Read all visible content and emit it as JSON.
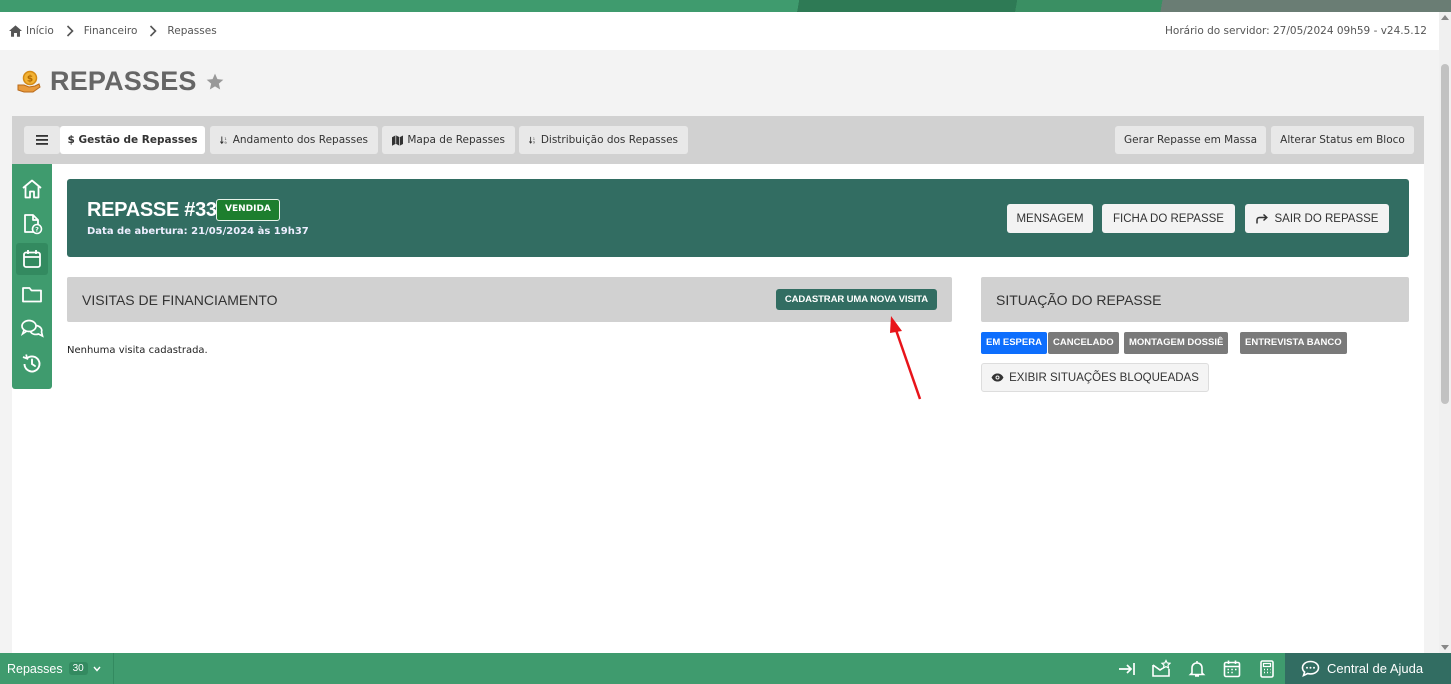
{
  "breadcrumb": {
    "items": [
      {
        "label": "Início"
      },
      {
        "label": "Financeiro"
      },
      {
        "label": "Repasses"
      }
    ],
    "server_time": "Horário do servidor: 27/05/2024 09h59 - v24.5.12"
  },
  "page": {
    "title": "REPASSES"
  },
  "tabs": [
    {
      "label": "$ Gestão de Repasses",
      "active": true
    },
    {
      "label": "Andamento dos Repasses",
      "active": false
    },
    {
      "label": "Mapa de Repasses",
      "active": false
    },
    {
      "label": "Distribuição dos Repasses",
      "active": false
    }
  ],
  "toolbar": {
    "mass_label": "Gerar Repasse em Massa",
    "bulk_status_label": "Alterar Status em Bloco"
  },
  "repasse": {
    "title": "REPASSE #339",
    "status_badge": "VENDIDA",
    "opened": "Data de abertura: 21/05/2024 às 19h37",
    "btn_mensagem": "MENSAGEM",
    "btn_ficha": "FICHA DO REPASSE",
    "btn_sair": "SAIR DO REPASSE"
  },
  "visitas": {
    "title": "VISITAS DE FINANCIAMENTO",
    "add_button": "CADASTRAR UMA NOVA VISITA",
    "empty": "Nenhuma visita cadastrada."
  },
  "situacao": {
    "title": "SITUAÇÃO DO REPASSE",
    "tags": [
      {
        "label": "EM ESPERA",
        "color": "#0d6efd"
      },
      {
        "label": "CANCELADO",
        "color": "#7a7a7a"
      },
      {
        "label": "MONTAGEM DOSSIÊ",
        "color": "#7a7a7a"
      },
      {
        "label": "ENTREVISTA BANCO",
        "color": "#7a7a7a"
      }
    ],
    "show_blocked": "EXIBIR SITUAÇÕES BLOQUEADAS"
  },
  "bottom": {
    "module": "Repasses",
    "count": "30",
    "help": "Central de Ajuda"
  },
  "colors": {
    "brand_green": "#3f9b6e",
    "dark_teal": "#326d62",
    "annotation_arrow": "#e8141a"
  }
}
